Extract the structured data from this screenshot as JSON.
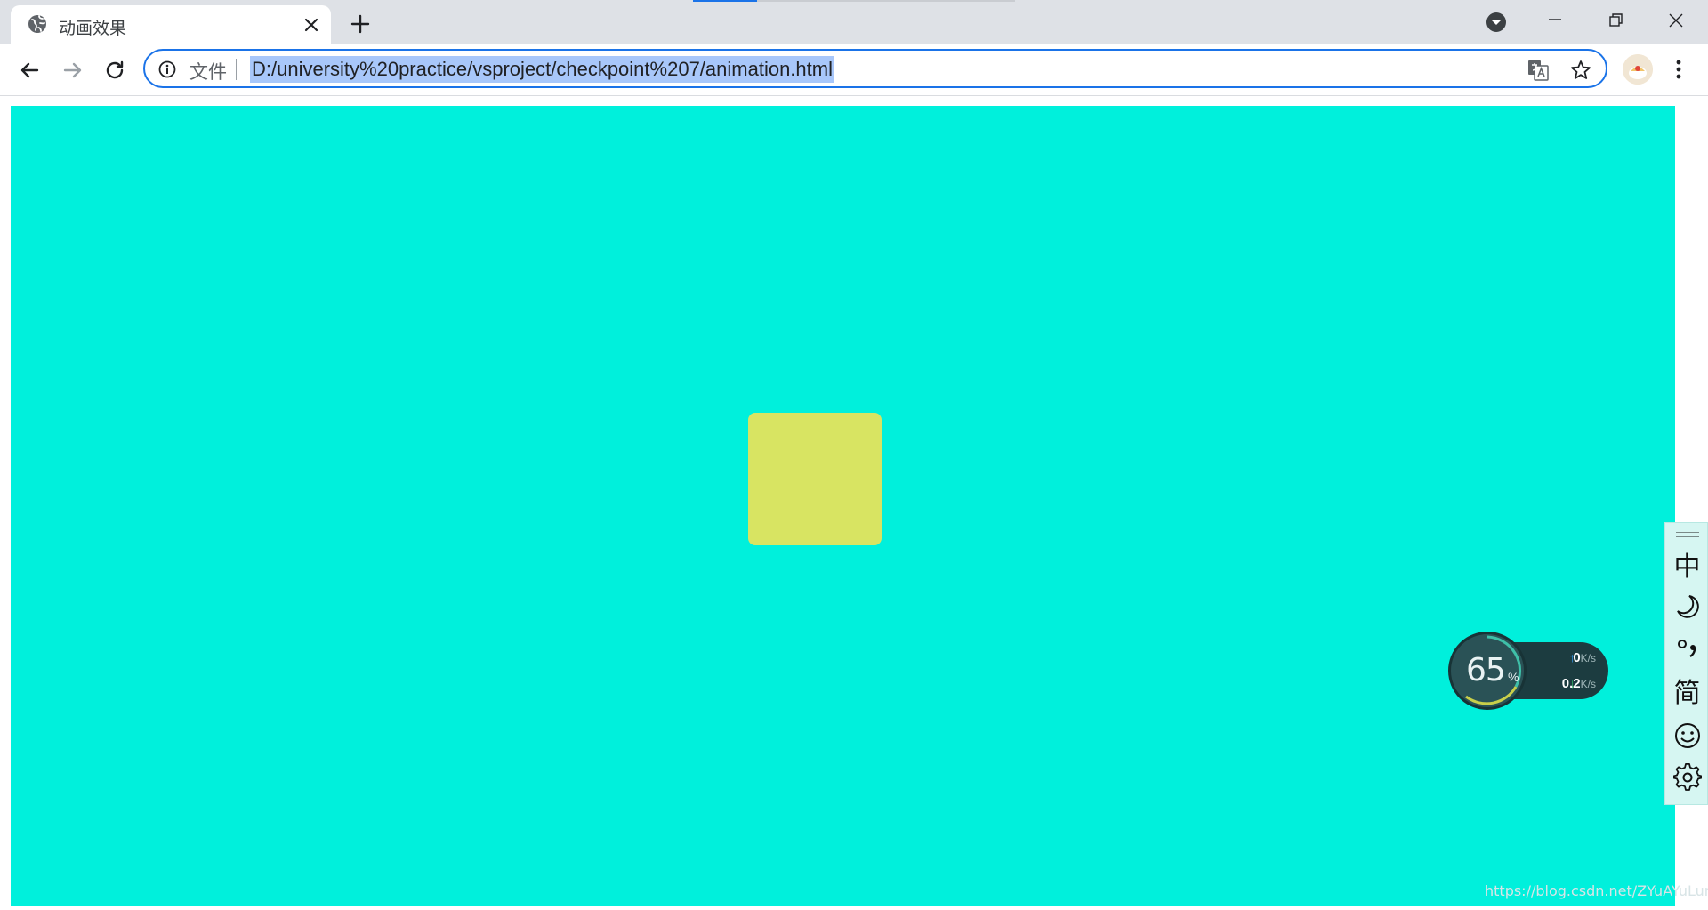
{
  "browser": {
    "tab": {
      "title": "动画效果"
    },
    "omnibox": {
      "scheme_label": "文件",
      "url": "D:/university%20practice/vsproject/checkpoint%207/animation.html"
    }
  },
  "page": {
    "background_color": "#00f0dc",
    "box_color": "#d8e462"
  },
  "speed_widget": {
    "percent": "65",
    "percent_sign": "%",
    "upload_value": "0",
    "upload_unit": "K/s",
    "download_value": "0.2",
    "download_unit": "K/s"
  },
  "ime_toolbar": {
    "items": [
      "中",
      "简"
    ]
  },
  "watermark": "https://blog.csdn.net/ZYuAYuLuna"
}
